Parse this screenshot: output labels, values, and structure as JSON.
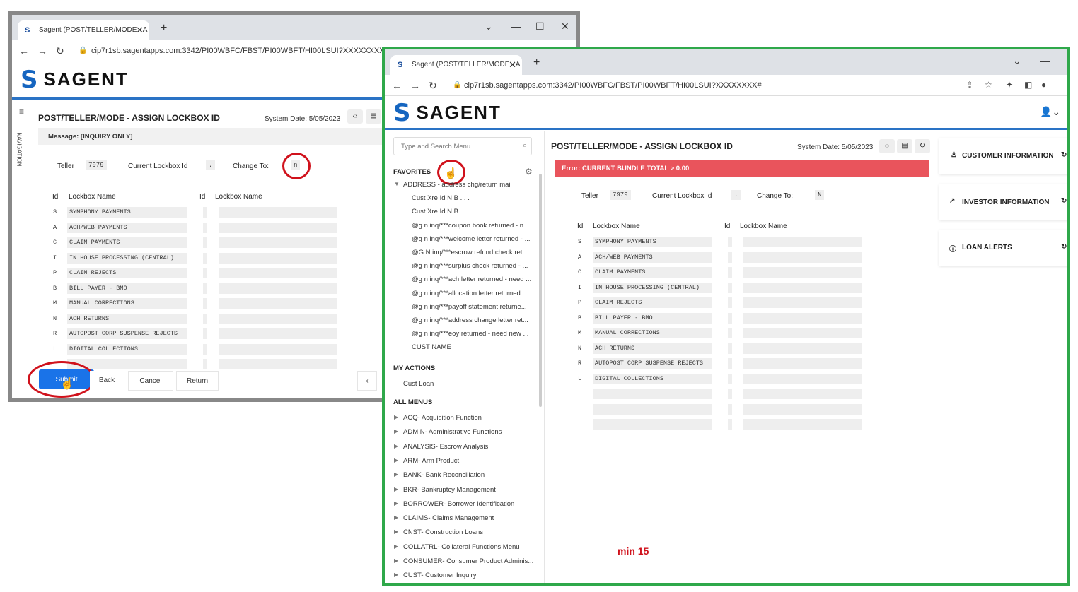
{
  "back_window": {
    "tab_title": "Sagent (POST/TELLER/MODE - A",
    "url": "cip7r1sb.sagentapps.com:3342/PI00WBFC/FBST/PI00WBFT/HI00LSUI?XXXXXXXX",
    "logo_text": "SAGENT",
    "nav_label": "NAVIGATION",
    "page_title": "POST/TELLER/MODE - ASSIGN LOCKBOX ID",
    "system_date": "System Date: 5/05/2023",
    "message": "Message: [INQUIRY ONLY]",
    "teller_label": "Teller",
    "teller_value": "7979",
    "current_lockbox_label": "Current Lockbox Id",
    "current_lockbox_value": ".",
    "change_to_label": "Change To:",
    "change_to_value": "n",
    "col_id": "Id",
    "col_lockbox_name": "Lockbox  Name",
    "col_id2": "Id",
    "col_lockbox_name2": "Lockbox  Name",
    "rows": [
      {
        "id": "S",
        "name": "SYMPHONY PAYMENTS"
      },
      {
        "id": "A",
        "name": "ACH/WEB PAYMENTS"
      },
      {
        "id": "C",
        "name": "CLAIM PAYMENTS"
      },
      {
        "id": "I",
        "name": "IN HOUSE PROCESSING (CENTRAL)"
      },
      {
        "id": "P",
        "name": "CLAIM REJECTS"
      },
      {
        "id": "B",
        "name": "BILL PAYER - BMO"
      },
      {
        "id": "M",
        "name": "MANUAL CORRECTIONS"
      },
      {
        "id": "N",
        "name": "ACH RETURNS"
      },
      {
        "id": "R",
        "name": "AUTOPOST CORP SUSPENSE REJECTS"
      },
      {
        "id": "L",
        "name": "DIGITAL COLLECTIONS"
      }
    ],
    "buttons": {
      "submit": "Submit",
      "back": "Back",
      "cancel": "Cancel",
      "return": "Return"
    }
  },
  "front_window": {
    "tab_title": "Sagent (POST/TELLER/MODE - A",
    "url": "cip7r1sb.sagentapps.com:3342/PI00WBFC/FBST/PI00WBFT/HI00LSUI?XXXXXXXX#",
    "logo_text": "SAGENT",
    "search_placeholder": "Type and Search Menu",
    "favorites_label": "FAVORITES",
    "favorites": [
      "ADDRESS - address chg/return mail",
      "Cust Xre Id N B . . .",
      "Cust Xre Id N B . . .",
      "@g n inq/***coupon book returned - n...",
      "@g n inq/***welcome letter returned - ...",
      "@G N inq/***escrow refund check ret...",
      "@g n inq/***surplus check returned - ...",
      "@g n inq/***ach letter returned - need ...",
      "@g n inq/***allocation letter returned ...",
      "@g n inq/***payoff statement returne...",
      "@g n inq/***address change letter ret...",
      "@g n inq/***eoy returned - need new ...",
      "CUST NAME"
    ],
    "my_actions_label": "MY ACTIONS",
    "my_actions": [
      "Cust Loan"
    ],
    "all_menus_label": "ALL MENUS",
    "all_menus": [
      "ACQ- Acquisition Function",
      "ADMIN- Administrative Functions",
      "ANALYSIS- Escrow Analysis",
      "ARM- Arm Product",
      "BANK- Bank Reconciliation",
      "BKR- Bankruptcy Management",
      "BORROWER- Borrower Identification",
      "CLAIMS- Claims Management",
      "CNST- Construction Loans",
      "COLLATRL- Collateral Functions Menu",
      "CONSUMER- Consumer Product Adminis...",
      "CUST- Customer Inquiry"
    ],
    "page_title": "POST/TELLER/MODE - ASSIGN LOCKBOX ID",
    "system_date": "System Date: 5/05/2023",
    "error": "Error: CURRENT BUNDLE TOTAL > 0.00",
    "teller_label": "Teller",
    "teller_value": "7979",
    "current_lockbox_label": "Current Lockbox Id",
    "current_lockbox_value": ".",
    "change_to_label": "Change To:",
    "change_to_value": "N",
    "col_id": "Id",
    "col_lockbox_name": "Lockbox  Name",
    "col_id2": "Id",
    "col_lockbox_name2": "Lockbox  Name",
    "rows": [
      {
        "id": "S",
        "name": "SYMPHONY PAYMENTS"
      },
      {
        "id": "A",
        "name": "ACH/WEB PAYMENTS"
      },
      {
        "id": "C",
        "name": "CLAIM PAYMENTS"
      },
      {
        "id": "I",
        "name": "IN HOUSE PROCESSING (CENTRAL)"
      },
      {
        "id": "P",
        "name": "CLAIM REJECTS"
      },
      {
        "id": "B",
        "name": "BILL PAYER - BMO"
      },
      {
        "id": "M",
        "name": "MANUAL CORRECTIONS"
      },
      {
        "id": "N",
        "name": "ACH RETURNS"
      },
      {
        "id": "R",
        "name": "AUTOPOST CORP SUSPENSE REJECTS"
      },
      {
        "id": "L",
        "name": "DIGITAL COLLECTIONS"
      }
    ],
    "cards": {
      "customer": "CUSTOMER INFORMATION",
      "investor": "INVESTOR INFORMATION",
      "alerts": "LOAN ALERTS"
    },
    "annotation": "min 15"
  },
  "colors": {
    "brand": "#1565c0",
    "error": "#e9545c",
    "frame": "#2fa84a",
    "highlight": "#d0121c",
    "submit": "#1a73e8"
  }
}
